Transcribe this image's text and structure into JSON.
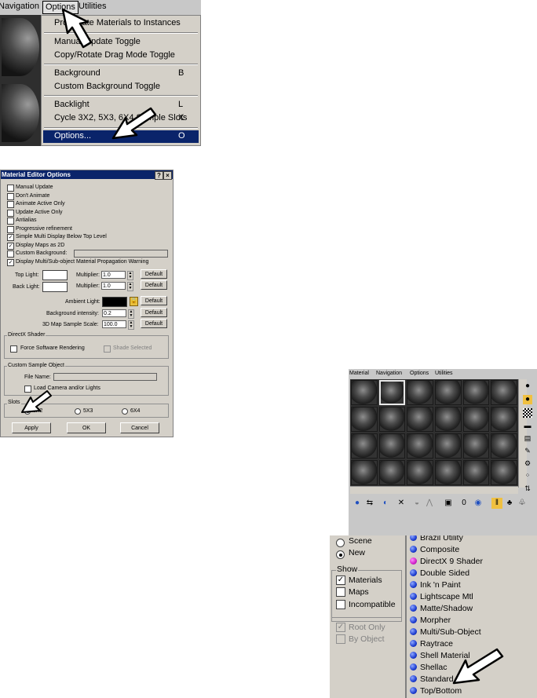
{
  "options_menu": {
    "menubar": [
      "Navigation",
      "Options",
      "Utilities"
    ],
    "items": [
      {
        "label": "Propagate Materials to Instances",
        "shortcut": ""
      },
      {
        "label": "Manual Update Toggle",
        "shortcut": ""
      },
      {
        "label": "Copy/Rotate Drag Mode Toggle",
        "shortcut": ""
      },
      {
        "label": "Background",
        "shortcut": "B"
      },
      {
        "label": "Custom Background Toggle",
        "shortcut": ""
      },
      {
        "label": "Backlight",
        "shortcut": "L"
      },
      {
        "label": "Cycle 3X2, 5X3, 6X4 Sample Slots",
        "shortcut": "X"
      },
      {
        "label": "Options...",
        "shortcut": "O"
      }
    ]
  },
  "dialog": {
    "title": "Material Editor Options",
    "help_button": "?",
    "close_button": "×",
    "checkboxes": [
      {
        "label": "Manual Update",
        "checked": false
      },
      {
        "label": "Don't Animate",
        "checked": false
      },
      {
        "label": "Animate Active Only",
        "checked": false
      },
      {
        "label": "Update Active Only",
        "checked": false
      },
      {
        "label": "Antialias",
        "checked": false
      },
      {
        "label": "Progressive refinement",
        "checked": false
      },
      {
        "label": "Simple Multi Display Below Top Level",
        "checked": true
      },
      {
        "label": "Display Maps as 2D",
        "checked": true
      },
      {
        "label": "Custom Background:",
        "checked": false
      },
      {
        "label": "Display Multi/Sub-object Material Propagation Warning",
        "checked": true
      }
    ],
    "top_light_label": "Top Light:",
    "back_light_label": "Back Light:",
    "multiplier_label": "Multiplier:",
    "top_multiplier": "1.0",
    "back_multiplier": "1.0",
    "ambient_light_label": "Ambient Light:",
    "background_intensity_label": "Background intensity:",
    "background_intensity": "0.2",
    "map_scale_label": "3D Map Sample Scale:",
    "map_scale": "100.0",
    "default_label": "Default",
    "directx_group": "DirectX Shader",
    "force_software": "Force Software Rendering",
    "shade_selected": "Shade Selected",
    "custom_sample_group": "Custom Sample Object",
    "file_name_label": "File Name:",
    "load_camera": "Load Camera and/or Lights",
    "slots_group": "Slots",
    "slot_options": [
      "3X2",
      "5X3",
      "6X4"
    ],
    "apply": "Apply",
    "ok": "OK",
    "cancel": "Cancel",
    "colors": {
      "top_light": "#ffffff",
      "back_light": "#ffffff",
      "ambient": "#000000"
    }
  },
  "editor": {
    "menubar": [
      "Material",
      "Navigation",
      "Options",
      "Utilities"
    ],
    "grid": {
      "rows": 4,
      "cols": 6,
      "selected": [
        0,
        1
      ]
    },
    "side_icons": [
      "sample-type-icon",
      "backlight-icon",
      "background-icon",
      "tiling-icon",
      "video-check-icon",
      "preview-icon",
      "options-icon",
      "select-by-material-icon",
      "material-navigator-icon"
    ],
    "toolbar_icons": [
      "get-material-icon",
      "put-to-scene-icon",
      "assign-icon",
      "reset-icon",
      "copy-icon",
      "unique-icon",
      "library-icon",
      "effects-channel-icon",
      "show-map-icon",
      "show-end-icon",
      "go-parent-icon",
      "go-sibling-icon"
    ]
  },
  "browser": {
    "browse_from_partial": [
      "Scene",
      "New"
    ],
    "browse_selected": "New",
    "show_label": "Show",
    "show_options": [
      {
        "label": "Materials",
        "checked": true
      },
      {
        "label": "Maps",
        "checked": false
      },
      {
        "label": "Incompatible",
        "checked": false
      }
    ],
    "root_only": "Root Only",
    "by_object": "By Object",
    "materials": [
      {
        "label": "Brazil Utility",
        "color": "blue"
      },
      {
        "label": "Composite",
        "color": "blue"
      },
      {
        "label": "DirectX 9 Shader",
        "color": "magenta"
      },
      {
        "label": "Double Sided",
        "color": "blue"
      },
      {
        "label": "Ink 'n Paint",
        "color": "blue"
      },
      {
        "label": "Lightscape Mtl",
        "color": "blue"
      },
      {
        "label": "Matte/Shadow",
        "color": "blue"
      },
      {
        "label": "Morpher",
        "color": "blue"
      },
      {
        "label": "Multi/Sub-Object",
        "color": "blue"
      },
      {
        "label": "Raytrace",
        "color": "blue"
      },
      {
        "label": "Shell Material",
        "color": "blue"
      },
      {
        "label": "Shellac",
        "color": "blue"
      },
      {
        "label": "Standard",
        "color": "blue"
      },
      {
        "label": "Top/Bottom",
        "color": "blue"
      }
    ]
  }
}
